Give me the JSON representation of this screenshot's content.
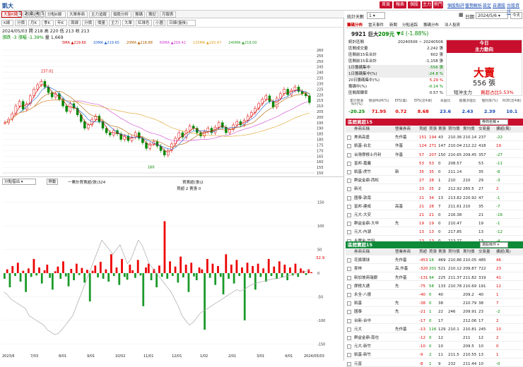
{
  "window": {
    "title": "凱大",
    "tb": [
      "首頁",
      "報表",
      "個股",
      "主力",
      "熱門"
    ],
    "links": [
      "個股點評",
      "盤勢解析",
      "設定",
      "自選股",
      "台股資訊"
    ]
  },
  "tabs1": [
    "大盤K線",
    "即時走勢",
    "分點K線",
    "大單券商",
    "主力追蹤",
    "個股分析",
    "籌碼",
    "籌記",
    "月報表"
  ],
  "tabs2": [
    "K線",
    "分價",
    "月K",
    "季K",
    "年K",
    "周線",
    "分價",
    "價量",
    "主力",
    "大單",
    "紅綠色",
    "小圖",
    "日線(盤後)"
  ],
  "stock": {
    "date": "2024/05/03",
    "open_label": "開",
    "open": "218",
    "high_label": "高",
    "high": "220",
    "low_label": "低",
    "low": "213",
    "close_label": "收",
    "close": "213",
    "chg_label": "漲跌",
    "chg": "-3",
    "pct_label": "漲幅",
    "pct": "-1.39%",
    "vol_label": "量",
    "vol": "1,669"
  },
  "ma": [
    "5MA ▲219.60",
    "10MA ▲219.65",
    "20MA ▲218.88",
    "60MA ▲209.42",
    "120MA ▲193.47",
    "240MA ▲218.00"
  ],
  "ma_colors": [
    "#d00000",
    "#2060d0",
    "#b06000",
    "#d040d0",
    "#e0a020",
    "#30a030"
  ],
  "price_axis": [
    "260",
    "255",
    "250",
    "245",
    "240",
    "235",
    "230",
    "225",
    "220",
    "215",
    "210",
    "205",
    "200",
    "195",
    "190",
    "185",
    "180",
    "175",
    "170",
    "165",
    "160",
    "155",
    "150"
  ],
  "chip_axis": [
    "150",
    "100",
    "50",
    "0",
    "-50",
    "-100",
    "-150"
  ],
  "price_annot": {
    "hi": "237.01",
    "lo": "160"
  },
  "chip_val": "32.9",
  "mid": {
    "sel1": "分點借出",
    "btn": "移動",
    "cum": "一累計買賣超(張)324",
    "l2": "買賣超(張)2",
    "l3": "買超 2 賣張 0"
  },
  "xlabels": [
    "2023/6",
    "7/03",
    "8/01",
    "9/01",
    "10/02",
    "11/01",
    "12/01",
    "1/02",
    "2/01",
    "3/01",
    "4/01",
    "2024/05/03"
  ],
  "footer": [
    "1",
    "2",
    "3",
    "4",
    "5"
  ],
  "price_series": [
    195,
    198,
    203,
    210,
    214,
    207,
    212,
    219,
    225,
    229,
    232,
    227,
    222,
    218,
    221,
    216,
    210,
    205,
    212,
    208,
    202,
    196,
    190,
    193,
    198,
    201,
    196,
    190,
    186,
    184,
    188,
    185,
    180,
    183,
    179,
    182,
    186,
    181,
    177,
    172,
    176,
    178,
    174,
    170,
    166,
    170,
    176,
    181,
    186,
    182,
    188,
    192,
    190,
    186,
    183,
    187,
    190,
    186,
    191,
    195,
    191,
    186,
    189,
    193,
    196,
    193,
    197,
    201,
    204,
    208,
    212,
    216,
    219,
    214,
    209,
    217,
    221,
    225,
    220,
    224,
    227,
    223,
    221,
    219,
    213
  ],
  "chip_bars": [
    -12,
    8,
    -30,
    15,
    -6,
    22,
    -18,
    5,
    -40,
    10,
    -8,
    30,
    -5,
    12,
    -22,
    6,
    18,
    -10,
    -35,
    4,
    14,
    -12,
    25,
    -7,
    -28,
    9,
    -15,
    20,
    -4,
    11,
    -20,
    7,
    -60,
    5,
    16,
    -9,
    24,
    -12,
    8,
    -18,
    40,
    -6,
    12,
    -25,
    30,
    -8,
    -14,
    18,
    6,
    -10,
    28,
    -5,
    -70,
    12,
    20,
    -15,
    9,
    -30,
    16,
    -8,
    110,
    -12,
    25,
    -6,
    14,
    -20,
    35,
    -9,
    18,
    -40,
    22,
    -7,
    -15,
    12,
    8,
    -120,
    30,
    -10,
    20,
    -25,
    15,
    -8,
    -45,
    40,
    -12,
    18,
    -22,
    28,
    -6,
    12,
    -100,
    22,
    -10,
    15,
    -35,
    20,
    -8,
    10,
    -18,
    30,
    -6,
    14,
    -12,
    25,
    -9,
    18,
    -15,
    12,
    -5,
    20,
    -8,
    10,
    5,
    -4,
    8,
    2
  ],
  "chip_cum": [
    -40,
    -45,
    -55,
    -60,
    -65,
    -70,
    -75,
    -90,
    -95,
    -100,
    -105,
    -110,
    -120,
    -125,
    -130,
    -128,
    -120,
    -110,
    -100,
    -90,
    -70,
    -50,
    -30,
    -10,
    10,
    30,
    50,
    70,
    60,
    50,
    40,
    50,
    60,
    40,
    20,
    30,
    50,
    70,
    60,
    40,
    20,
    10,
    0,
    -10,
    -20,
    -30,
    -40,
    -55,
    -70,
    -90,
    -100,
    -110,
    -105,
    -95,
    -85,
    -80,
    -75,
    -70,
    -65,
    -60,
    -55,
    -50,
    -45,
    -40,
    -35,
    -38,
    -35,
    -30,
    -25,
    -22,
    -20,
    -18,
    -16,
    -14,
    -12,
    -12,
    -10,
    -8,
    -6,
    -4,
    -2,
    0,
    2,
    4,
    6
  ],
  "right": {
    "stat_label": "統計天數",
    "stat_val": "1",
    "date_label": "日期",
    "date_val": "2024/5/6",
    "today_btn": "今天",
    "rtabs": [
      "籌碼分佈",
      "當天事件",
      "新聞",
      "分點追踪",
      "籌碼分布",
      "法人投資"
    ],
    "code": "9921 巨大",
    "price": "209元",
    "chg": "▼4 (-1.88%)",
    "stats": [
      [
        "統計區間",
        "20240506 ~ 20240506"
      ],
      [
        "區間成交量",
        "2,242 張"
      ],
      [
        "區間前15名合計",
        "602 張"
      ],
      [
        "區間前15名合計",
        "-1,158 張"
      ],
      [
        "1日籌碼集中",
        "-556 張"
      ],
      [
        "1日籌碼集中(%)",
        "-24.8 %"
      ],
      [
        "20日籌碼集中(%)",
        "5.29 %"
      ],
      [
        "籌碼中(%)",
        "-0.14 %"
      ],
      [
        "區間周轉率",
        "0.57 %"
      ]
    ],
    "today": "今日",
    "today_sub": "主力動向",
    "big": "大賣",
    "amount": "556 張",
    "short_label": "短沖主力",
    "short_val": "買超占比5.53%",
    "metrics_h": [
      "累計營收YoY(%)",
      "營收MoM(%)",
      "EPS(萬)",
      "EPS(近4季)",
      "本益比",
      "股價淨值比",
      "殖利率(%)",
      "ROE(近4季)"
    ],
    "metrics_v": [
      "-20.25",
      "71.95",
      "0.72",
      "8.68",
      "23.6",
      "2.43",
      "2.39",
      "10.1"
    ],
    "buy_title": "區間買超15",
    "buy_sel": "券商名稱",
    "cols": [
      "",
      "券商名稱",
      "營業券商",
      "買超",
      "買張",
      "賣張",
      "買均價",
      "賣均價",
      "交易量",
      "擴超(萬)"
    ],
    "buy_rows": [
      [
        "美商高盛",
        "先作基",
        "151",
        "194",
        "43",
        "210.36",
        "210.14",
        "237",
        "-22"
      ],
      [
        "凱基-台北",
        "作基",
        "124",
        "271",
        "147",
        "210.04",
        "212.22",
        "418",
        "19"
      ],
      [
        "台灣摩根士丹利",
        "作基",
        "57",
        "207",
        "150",
        "210.65",
        "209.45",
        "357",
        "-27"
      ],
      [
        "富邦-嘉義",
        "",
        "53",
        "53",
        "0",
        "208.57",
        "",
        "53",
        "-11"
      ],
      [
        "凱基-虎竹",
        "新",
        "35",
        "35",
        "0",
        "211.14",
        "",
        "35",
        "-8"
      ],
      [
        "群益金鼎-西松",
        "",
        "27",
        "28",
        "1",
        "210",
        "210",
        "29",
        "-3"
      ],
      [
        "新光",
        "",
        "23",
        "25",
        "2",
        "212.92",
        "265.5",
        "27",
        "2"
      ],
      [
        "國泰-敦南",
        "",
        "21",
        "34",
        "13",
        "213.82",
        "220.92",
        "47",
        "-1"
      ],
      [
        "富邦-建成",
        "高基",
        "21",
        "28",
        "7",
        "211.61",
        "210",
        "35",
        "-7"
      ],
      [
        "元大-大安",
        "",
        "21",
        "21",
        "0",
        "216.38",
        "",
        "21",
        "-16"
      ],
      [
        "群益金鼎-大甲",
        "先",
        "19",
        "19",
        "0",
        "210.47",
        "",
        "19",
        "-1"
      ],
      [
        "元大-內湖",
        "",
        "13",
        "13",
        "0",
        "217.85",
        "",
        "13",
        "-12"
      ],
      [
        "永豐金-竹科",
        "",
        "13",
        "13",
        "0",
        "213.77",
        "",
        "13",
        "-4"
      ]
    ],
    "sell_title": "區間賣超15",
    "sell_sel": "選股條件",
    "sell_rows": [
      [
        "花旗環球",
        "先作基",
        "-453",
        "16",
        "469",
        "210.86",
        "210.05",
        "485",
        "46"
      ],
      [
        "麥林",
        "高,作基",
        "-320",
        "201",
        "521",
        "210.12",
        "209.87",
        "722",
        "23"
      ],
      [
        "新加坡商瑞銀",
        "先作基",
        "-131",
        "94",
        "225",
        "211.37",
        "211.82",
        "319",
        "41"
      ],
      [
        "摩根大通",
        "先",
        "-75",
        "58",
        "133",
        "210.78",
        "210.69",
        "191",
        "12"
      ],
      [
        "永全-八德",
        "",
        "-40",
        "0",
        "40",
        "",
        "209.2",
        "40",
        "1"
      ],
      [
        "凱基",
        "先",
        "-38",
        "0",
        "38",
        "",
        "210.79",
        "38",
        "7"
      ],
      [
        "國泰",
        "先",
        "-21",
        "1",
        "22",
        "246",
        "209.91",
        "23",
        "-2"
      ],
      [
        "台新-台中",
        "",
        "-17",
        "0",
        "17",
        "",
        "212.06",
        "17",
        "2"
      ],
      [
        "元大",
        "先作基",
        "-13",
        "116",
        "129",
        "210.1",
        "210.81",
        "245",
        "10"
      ],
      [
        "群益金鼎-南也",
        "",
        "-12",
        "0",
        "12",
        "",
        "211",
        "12",
        "2"
      ],
      [
        "元大-新竹",
        "",
        "-10",
        "0",
        "10",
        "",
        "209.5",
        "10",
        "0"
      ],
      [
        "凱基-新竹",
        "",
        "-9",
        "2",
        "11",
        "211.5",
        "210.55",
        "13",
        "1"
      ],
      [
        "元富",
        "",
        "-8",
        "1",
        "9",
        "232",
        "211.44",
        "10",
        "-0"
      ]
    ]
  }
}
